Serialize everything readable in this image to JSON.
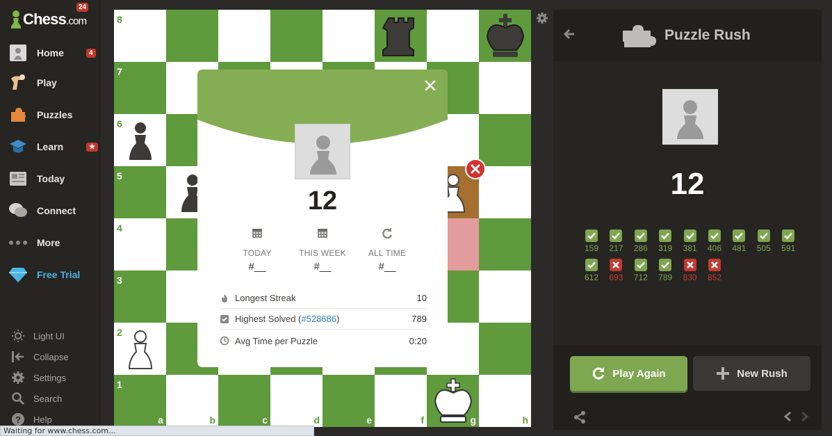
{
  "sidebar": {
    "logo_text": "Chess",
    "logo_suffix": ".com",
    "logo_badge": "24",
    "items": [
      {
        "label": "Home",
        "badge": "4"
      },
      {
        "label": "Play"
      },
      {
        "label": "Puzzles"
      },
      {
        "label": "Learn",
        "badge": "★"
      },
      {
        "label": "Today"
      },
      {
        "label": "Connect"
      },
      {
        "label": "More"
      },
      {
        "label": "Free Trial"
      }
    ],
    "bottom": [
      {
        "label": "Light UI"
      },
      {
        "label": "Collapse"
      },
      {
        "label": "Settings"
      },
      {
        "label": "Search"
      },
      {
        "label": "Help"
      }
    ]
  },
  "board": {
    "ranks": [
      "8",
      "7",
      "6",
      "5",
      "4",
      "3",
      "2",
      "1"
    ],
    "files": [
      "a",
      "b",
      "c",
      "d",
      "e",
      "f",
      "g",
      "h"
    ]
  },
  "modal": {
    "score": "12",
    "stats": [
      {
        "label": "TODAY",
        "value": "#__"
      },
      {
        "label": "THIS WEEK",
        "value": "#__"
      },
      {
        "label": "ALL TIME",
        "value": "#__"
      }
    ],
    "rows": {
      "longest_label": "Longest Streak",
      "longest_value": "10",
      "highest_label": "Highest Solved (",
      "highest_link": "#528686",
      "highest_suffix": ")",
      "highest_value": "789",
      "avg_label": "Avg Time per Puzzle",
      "avg_value": "0:20"
    }
  },
  "panel": {
    "title": "Puzzle Rush",
    "score": "12",
    "results": [
      {
        "rating": "159",
        "ok": true
      },
      {
        "rating": "217",
        "ok": true
      },
      {
        "rating": "286",
        "ok": true
      },
      {
        "rating": "319",
        "ok": true
      },
      {
        "rating": "381",
        "ok": true
      },
      {
        "rating": "406",
        "ok": true
      },
      {
        "rating": "481",
        "ok": true
      },
      {
        "rating": "505",
        "ok": true
      },
      {
        "rating": "591",
        "ok": true
      },
      {
        "rating": "612",
        "ok": true
      },
      {
        "rating": "693",
        "ok": false
      },
      {
        "rating": "712",
        "ok": true
      },
      {
        "rating": "789",
        "ok": true
      },
      {
        "rating": "830",
        "ok": false
      },
      {
        "rating": "852",
        "ok": false
      }
    ],
    "play_again": "Play Again",
    "new_rush": "New Rush"
  },
  "status_bar": "Waiting for www.chess.com...",
  "colors": {
    "board_dark": "#5f9a3c",
    "board_light": "#ffffff",
    "success": "#7fa650",
    "error": "#c33a32",
    "accent": "#4cb3e5"
  }
}
